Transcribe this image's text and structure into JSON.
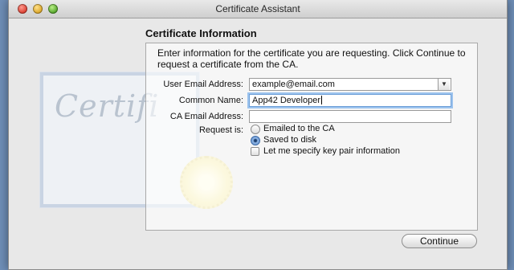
{
  "window": {
    "title": "Certificate Assistant"
  },
  "section": {
    "heading": "Certificate Information",
    "intro": "Enter information for the certificate you are requesting. Click Continue to request a certificate from the CA."
  },
  "form": {
    "user_email_label": "User Email Address:",
    "user_email_value": "example@email.com",
    "common_name_label": "Common Name:",
    "common_name_value": "App42 Developer",
    "ca_email_label": "CA Email Address:",
    "ca_email_value": "",
    "request_label": "Request is:",
    "options": [
      {
        "label": "Emailed to the CA",
        "selected": false
      },
      {
        "label": "Saved to disk",
        "selected": true
      }
    ],
    "key_pair_label": "Let me specify key pair information",
    "key_pair_checked": false
  },
  "buttons": {
    "continue_label": "Continue"
  },
  "background": {
    "certificate_script": "Certifi"
  }
}
